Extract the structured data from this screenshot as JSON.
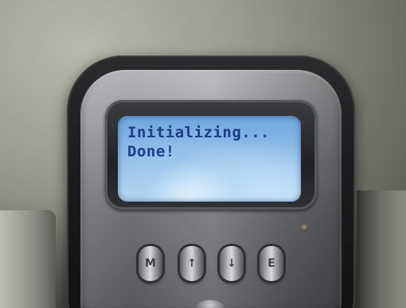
{
  "lcd": {
    "line1": "Initializing...",
    "line2": "Done!"
  },
  "buttons": [
    {
      "icon": "menu-button-icon",
      "glyph": "M"
    },
    {
      "icon": "up-arrow-icon",
      "glyph": "↑"
    },
    {
      "icon": "down-arrow-icon",
      "glyph": "↓"
    },
    {
      "icon": "enter-button-icon",
      "glyph": "E"
    }
  ],
  "colors": {
    "lcd_backlight": "#8ebde8",
    "lcd_text": "#1c3c86",
    "housing": "#1c1c1e",
    "faceplate": "#8e9094"
  }
}
